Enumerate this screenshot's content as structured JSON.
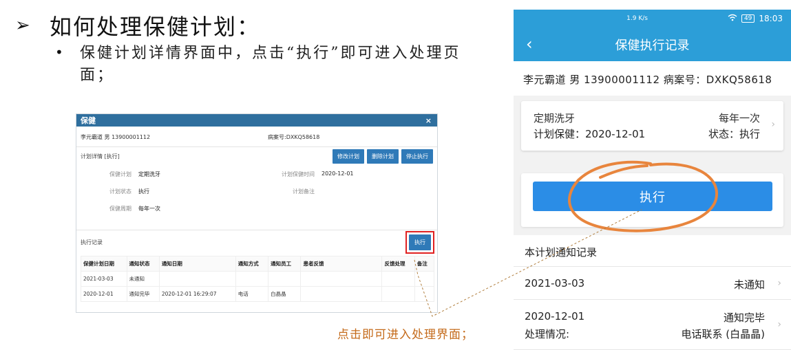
{
  "slide": {
    "arrow": "➢",
    "heading": "如何处理保健计划：",
    "bullet_dot": "•",
    "bullet": "保健计划详情界面中，点击“执行”即可进入处理页面；",
    "annotation": "点击即可进入处理界面；"
  },
  "dialog": {
    "title": "保健",
    "close": "×",
    "patient": "李元霸道 男 13900001112",
    "record_no": "病案号:DXKQ58618",
    "section_label": "计划详情 [执行]",
    "buttons": [
      "修改计划",
      "删除计划",
      "停止执行"
    ],
    "fields": {
      "plan_label": "保健计划",
      "plan_value": "定期洗牙",
      "status_label": "计划状态",
      "status_value": "执行",
      "cycle_label": "保健周期",
      "cycle_value": "每年一次",
      "time_label": "计划保健时间",
      "time_value": "2020-12-01",
      "note_label": "计划备注",
      "note_value": ""
    },
    "exec_section": "执行记录",
    "exec_button": "执行",
    "table": {
      "headers": [
        "保健计划日期",
        "通知状态",
        "通知日期",
        "通知方式",
        "通知员工",
        "患者反馈",
        "反馈处理",
        "备注"
      ],
      "rows": [
        [
          "2021-03-03",
          "未通知",
          "",
          "",
          "",
          "",
          "",
          ""
        ],
        [
          "2020-12-01",
          "通知完毕",
          "2020-12-01 16:29:07",
          "电话",
          "白晶晶",
          "",
          "",
          ""
        ]
      ]
    }
  },
  "phone": {
    "status": {
      "net": "1.9 K/s",
      "time": "18:03",
      "battery": "49"
    },
    "back": "‹",
    "title": "保健执行记录",
    "patient": "李元霸道  男 13900001112   病案号：DXKQ58618",
    "card": {
      "plan": "定期洗牙",
      "plan_date": "计划保健：2020-12-01",
      "cycle": "每年一次",
      "status": "状态：执行"
    },
    "exec_button": "执行",
    "section": "本计划通知记录",
    "records": [
      {
        "date": "2021-03-03",
        "status": "未通知"
      },
      {
        "date": "2020-12-01",
        "status": "通知完毕",
        "extra_label": "处理情况:",
        "extra_value": "电话联系 (白晶晶)"
      }
    ],
    "chevron": "›"
  },
  "colors": {
    "phone_header": "#2c9ed8",
    "button_blue": "#2b8de6",
    "dialog_header": "#2f6f9e",
    "highlight": "#e02020",
    "circle": "#e8853d"
  }
}
